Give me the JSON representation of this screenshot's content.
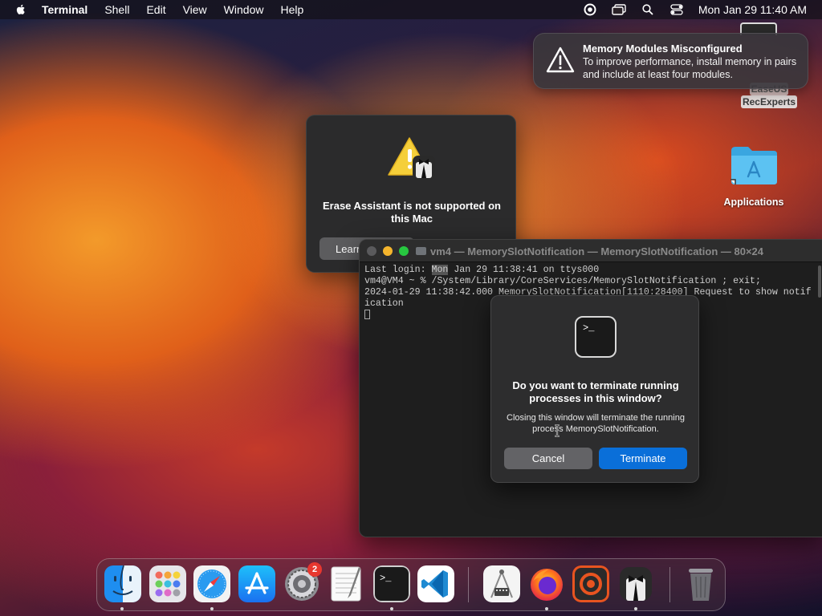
{
  "menubar": {
    "app": "Terminal",
    "items": [
      "Shell",
      "Edit",
      "View",
      "Window",
      "Help"
    ],
    "clock": "Mon Jan 29  11:40 AM"
  },
  "notification": {
    "title": "Memory Modules Misconfigured",
    "body": "To improve performance, install memory in pairs and include at least four modules."
  },
  "desktop": {
    "easeus_label_line1": "EaseUS",
    "easeus_label_line2": "RecExperts",
    "applications_label": "Applications"
  },
  "erase_alert": {
    "title": "Erase Assistant is not supported on this Mac",
    "button_label": "Learn"
  },
  "terminal": {
    "title": "vm4 — MemorySlotNotification — MemorySlotNotification — 80×24",
    "line1_prefix": "Last login: ",
    "line1_highlight": "Mon",
    "line1_suffix": " Jan 29 11:38:41 on ttys000",
    "line2": "vm4@VM4 ~ % /System/Library/CoreServices/MemorySlotNotification ; exit;",
    "line3": "2024-01-29 11:38:42.000 MemorySlotNotification[1110:28400] Request to show notif",
    "line4": "ication"
  },
  "sheet": {
    "icon_text": ">_",
    "title": "Do you want to terminate running processes in this window?",
    "body": "Closing this window will terminate the running process MemorySlotNotification.",
    "cancel_label": "Cancel",
    "terminate_label": "Terminate"
  },
  "dock": {
    "settings_badge": "2",
    "apps": [
      "finder-icon",
      "launchpad-icon",
      "safari-icon",
      "app-store-icon",
      "system-settings-icon",
      "textedit-icon",
      "terminal-icon",
      "vscode-icon",
      "system-information-icon",
      "firefox-icon",
      "recorder-icon",
      "erase-assistant-icon",
      "trash-icon"
    ]
  },
  "colors": {
    "accent_blue": "#0a6fd9",
    "traffic_yellow": "#f5b52d",
    "traffic_green": "#27c840",
    "badge_red": "#e8372f"
  }
}
